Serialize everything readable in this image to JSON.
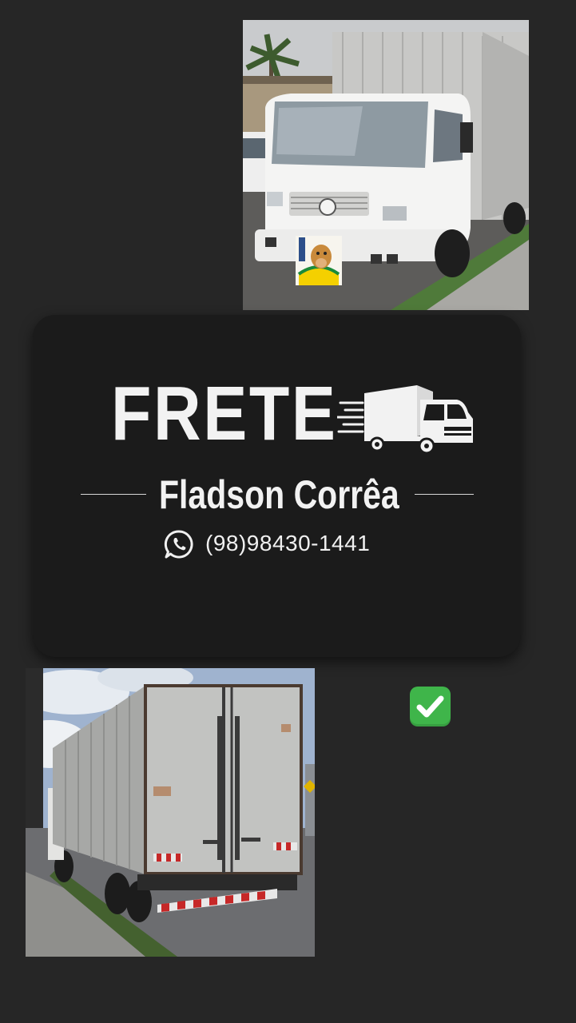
{
  "card": {
    "title": "FRETE",
    "name": "Fladson Corrêa",
    "phone": "(98)98430-1441"
  },
  "icons": {
    "title_icon": "delivery-truck-icon",
    "phone_icon": "whatsapp-icon",
    "badge_icon": "check-mark-button-emoji"
  },
  "photos": {
    "top": "white-vw-truck-photo",
    "bottom": "box-truck-rear-photo"
  },
  "colors": {
    "background": "#262626",
    "card": "#1b1b1b",
    "text": "#f2f2f2",
    "check_green": "#3fb54a"
  }
}
